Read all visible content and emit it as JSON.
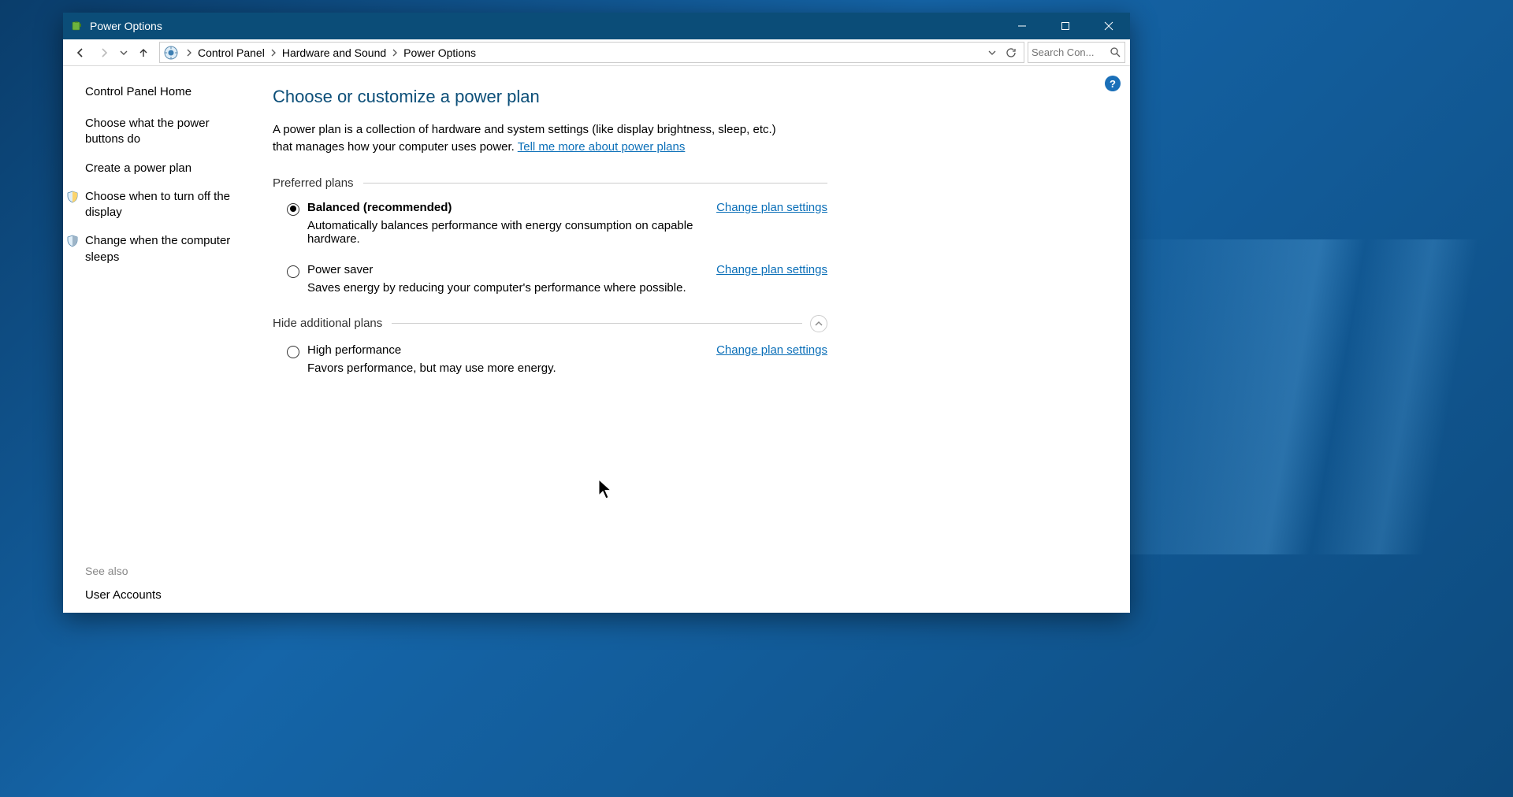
{
  "window": {
    "title": "Power Options"
  },
  "breadcrumb": {
    "items": [
      "Control Panel",
      "Hardware and Sound",
      "Power Options"
    ]
  },
  "search": {
    "placeholder": "Search Con..."
  },
  "sidebar": {
    "home": "Control Panel Home",
    "tasks": [
      {
        "label": "Choose what the power buttons do",
        "icon": null
      },
      {
        "label": "Create a power plan",
        "icon": null
      },
      {
        "label": "Choose when to turn off the display",
        "icon": "display"
      },
      {
        "label": "Change when the computer sleeps",
        "icon": "moon"
      }
    ],
    "see_also_header": "See also",
    "see_also": [
      {
        "label": "User Accounts"
      }
    ]
  },
  "main": {
    "title": "Choose or customize a power plan",
    "description": "A power plan is a collection of hardware and system settings (like display brightness, sleep, etc.) that manages how your computer uses power. ",
    "desc_link": "Tell me more about power plans",
    "groups": {
      "preferred_label": "Preferred plans",
      "additional_label": "Hide additional plans"
    },
    "change_link": "Change plan settings",
    "plans_preferred": [
      {
        "name": "Balanced (recommended)",
        "selected": true,
        "desc": "Automatically balances performance with energy consumption on capable hardware."
      },
      {
        "name": "Power saver",
        "selected": false,
        "desc": "Saves energy by reducing your computer's performance where possible."
      }
    ],
    "plans_additional": [
      {
        "name": "High performance",
        "selected": false,
        "desc": "Favors performance, but may use more energy."
      }
    ]
  },
  "help_badge": "?"
}
